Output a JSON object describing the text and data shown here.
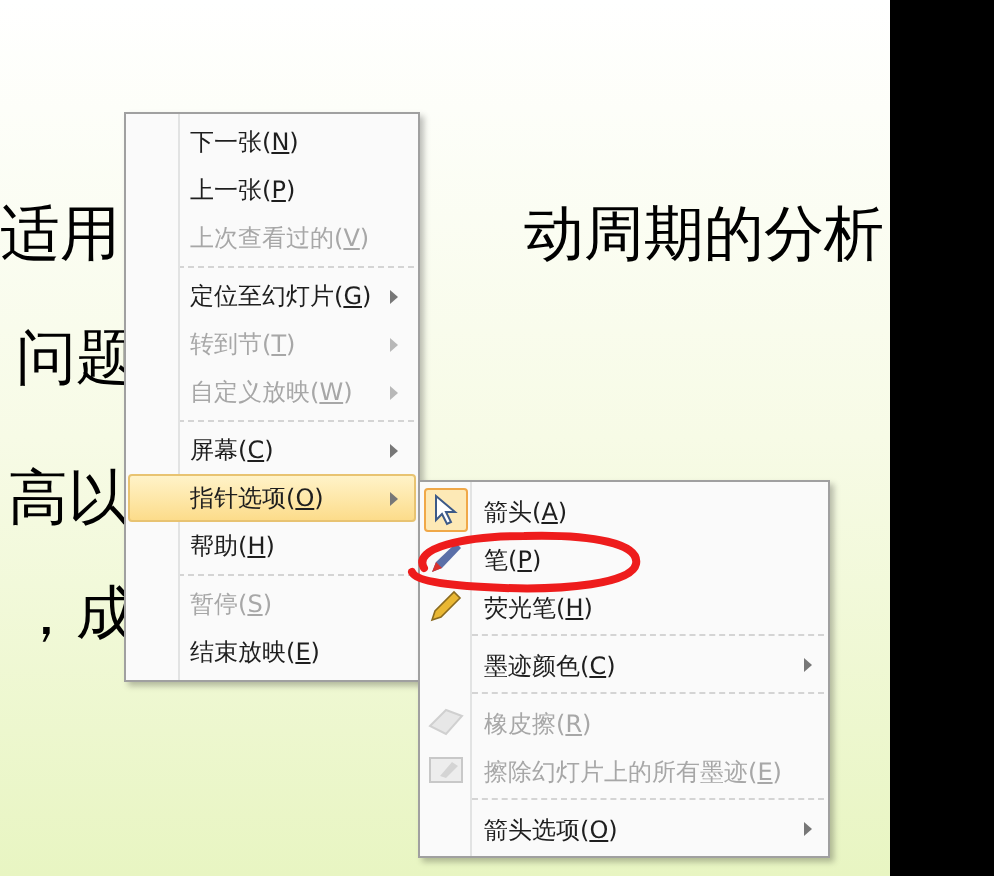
{
  "slide": {
    "text_fragments": [
      "适用",
      "动周期的分析",
      "问题",
      "高以",
      "，成"
    ]
  },
  "context_menu": {
    "items": [
      {
        "kind": "item",
        "text": "下一张(N)",
        "disabled": false,
        "has_submenu": false,
        "selected": false
      },
      {
        "kind": "item",
        "text": "上一张(P)",
        "disabled": false,
        "has_submenu": false,
        "selected": false
      },
      {
        "kind": "item",
        "text": "上次查看过的(V)",
        "disabled": true,
        "has_submenu": false,
        "selected": false
      },
      {
        "kind": "separator"
      },
      {
        "kind": "item",
        "text": "定位至幻灯片(G)",
        "disabled": false,
        "has_submenu": true,
        "selected": false
      },
      {
        "kind": "item",
        "text": "转到节(T)",
        "disabled": true,
        "has_submenu": true,
        "selected": false
      },
      {
        "kind": "item",
        "text": "自定义放映(W)",
        "disabled": true,
        "has_submenu": true,
        "selected": false
      },
      {
        "kind": "separator"
      },
      {
        "kind": "item",
        "text": "屏幕(C)",
        "disabled": false,
        "has_submenu": true,
        "selected": false
      },
      {
        "kind": "item",
        "text": "指针选项(O)",
        "disabled": false,
        "has_submenu": true,
        "selected": true
      },
      {
        "kind": "item",
        "text": "帮助(H)",
        "disabled": false,
        "has_submenu": false,
        "selected": false
      },
      {
        "kind": "separator"
      },
      {
        "kind": "item",
        "text": "暂停(S)",
        "disabled": true,
        "has_submenu": false,
        "selected": false
      },
      {
        "kind": "item",
        "text": "结束放映(E)",
        "disabled": false,
        "has_submenu": false,
        "selected": false
      }
    ]
  },
  "submenu": {
    "items": [
      {
        "kind": "tool",
        "text": "箭头(A)",
        "disabled": false,
        "checked": true
      },
      {
        "kind": "tool",
        "text": "笔(P)",
        "disabled": false,
        "checked": false
      },
      {
        "kind": "tool",
        "text": "荧光笔(H)",
        "disabled": false,
        "checked": false
      },
      {
        "kind": "separator"
      },
      {
        "kind": "item",
        "text": "墨迹颜色(C)",
        "disabled": false,
        "has_submenu": true
      },
      {
        "kind": "separator"
      },
      {
        "kind": "tool",
        "text": "橡皮擦(R)",
        "disabled": true,
        "checked": false
      },
      {
        "kind": "tool",
        "text": "擦除幻灯片上的所有墨迹(E)",
        "disabled": true,
        "checked": false
      },
      {
        "kind": "separator"
      },
      {
        "kind": "item",
        "text": "箭头选项(O)",
        "disabled": false,
        "has_submenu": true
      }
    ]
  }
}
